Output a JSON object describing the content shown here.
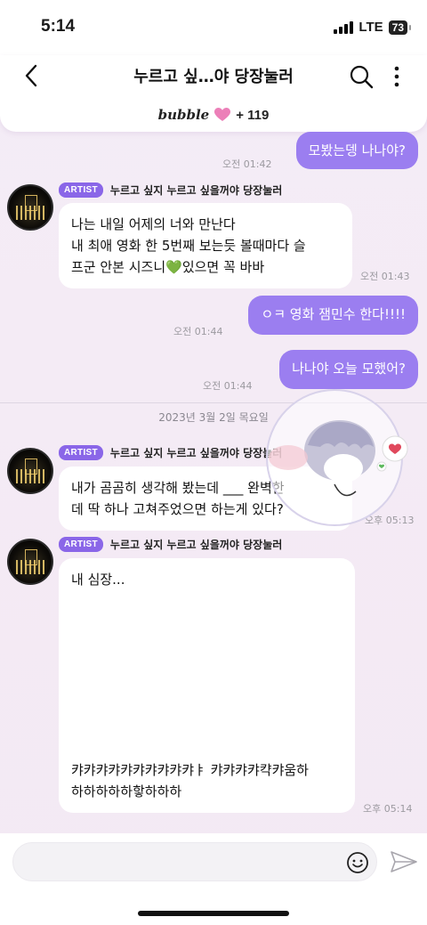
{
  "status": {
    "time": "5:14",
    "network": "LTE",
    "battery": "73"
  },
  "header": {
    "title": "누르고 싶…야 당장눌러",
    "bubble_logo": "bubble",
    "bubble_count": "+ 119"
  },
  "messages": {
    "m1": {
      "text": "모봤는뎅 나나야?",
      "time": "오전 01:42"
    },
    "a1": {
      "badge": "ARTIST",
      "name": "누르고 싶지 누르고 싶을꺼야 당장눌러",
      "lines": [
        "나는 내일 어제의 너와 만난다",
        "내 최애 영화 한 5번째 보는듯 볼때마다 슬",
        "프군 안본 시즈니💚있으면 꼭 바바"
      ],
      "time": "오전 01:43"
    },
    "m2": {
      "text": "ㅇㅋ 영화 잼민수 한다!!!!",
      "time": "오전 01:44"
    },
    "m3": {
      "text": "나나야 오늘 모했어?",
      "time": "오전 01:44"
    },
    "date": "2023년 3월 2일 목요일",
    "a2": {
      "badge": "ARTIST",
      "name": "누르고 싶지 누르고 싶을꺼야 당장눌러",
      "lines": [
        "내가 곰곰히 생각해 봤는데 ___ 완벽한",
        "데 딱 하나 고쳐주었으면 하는게 있다?"
      ],
      "time": "오후 05:13"
    },
    "a3": {
      "badge": "ARTIST",
      "name": "누르고 싶지 누르고 싶을꺼야 당장눌러",
      "first_line": "내 심장...",
      "last_lines": [
        "캬캬캬캬캬캬캬캬캬캬ㅑ 캬캬캬캬캭캬움하",
        "하하하하하핳하하하"
      ],
      "time": "오후 05:14"
    }
  },
  "input": {
    "placeholder": ""
  },
  "colors": {
    "accent": "#9b7ef0",
    "badge": "#8a66e8",
    "background": "#f3ecf6"
  }
}
